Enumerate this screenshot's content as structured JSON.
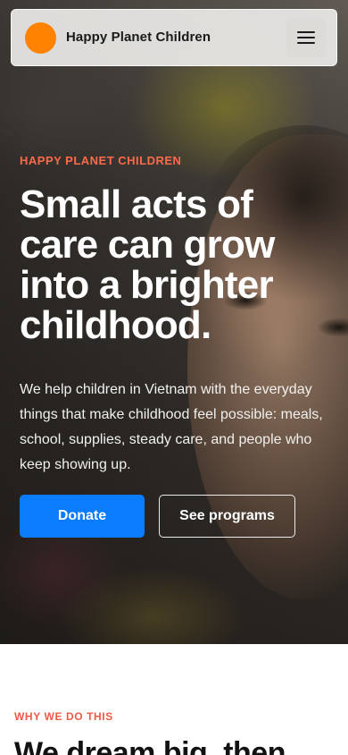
{
  "nav": {
    "brand": "Happy Planet Children",
    "logo_color": "#ff8200",
    "menu_icon": "hamburger-menu-icon"
  },
  "hero": {
    "eyebrow": "HAPPY PLANET CHILDREN",
    "title": "Small acts of care can grow into a brighter childhood.",
    "body": "We help children in Vietnam with the everyday things that make childhood feel possible: meals, school, supplies, steady care, and people who keep showing up.",
    "donate_label": "Donate",
    "programs_label": "See programs",
    "accent_color": "#ff6a4a",
    "donate_color": "#0a7cff"
  },
  "section": {
    "eyebrow": "WHY WE DO THIS",
    "title": "We dream big, then"
  }
}
